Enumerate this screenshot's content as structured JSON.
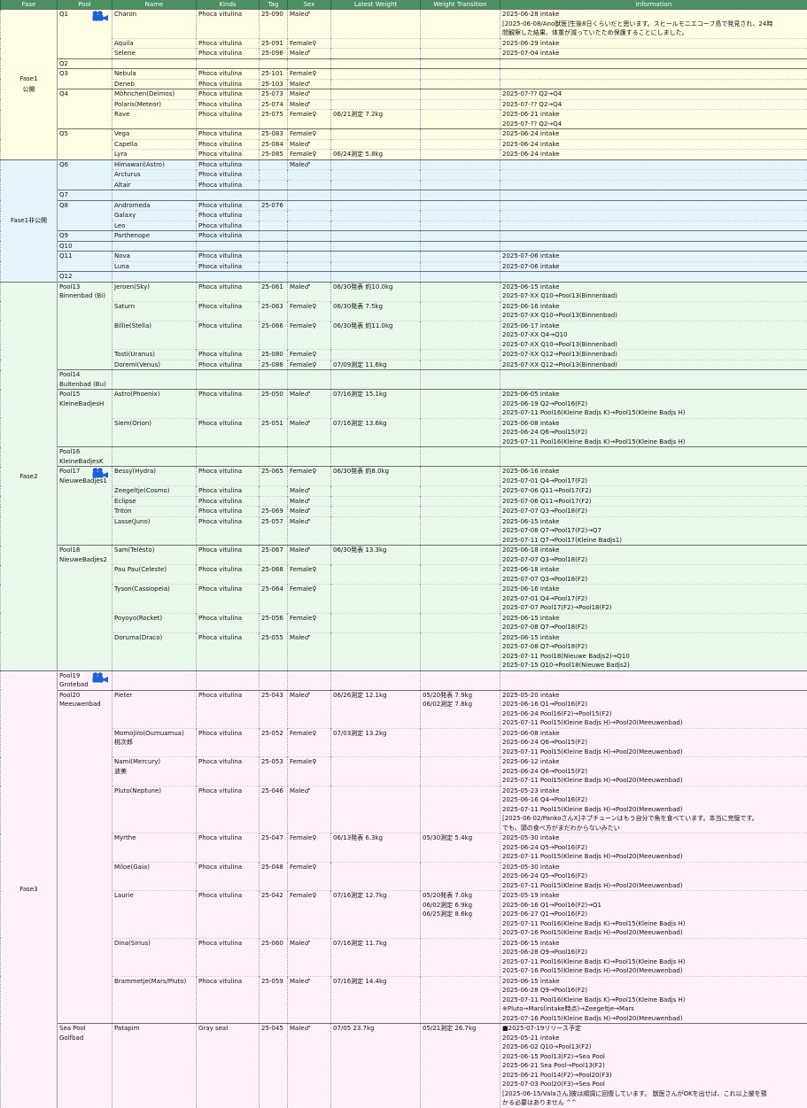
{
  "headers": {
    "fase": "Fase",
    "pool": "Pool",
    "name": "Name",
    "kinds": "Kinds",
    "tag": "Tag",
    "sex": "Sex",
    "weight": "Latest Weight",
    "trans": "Weight Transition",
    "info": "Information"
  },
  "colors": {
    "header": "#4c8f63",
    "fase1_public": "#fffde3",
    "fase1_private": "#e3f4fd",
    "fase2": "#e8f8ea",
    "fase3": "#fdf0fa",
    "camera_icon": "#1f5fd0"
  },
  "fases": [
    {
      "label": "Fase1\n公開",
      "bg": "#fffde3",
      "pools": [
        {
          "label": "Q1",
          "camera": true,
          "animals": [
            {
              "name": "Charon",
              "kinds": "Phoca vitulina",
              "tag": "25-090",
              "sex": "Male♂",
              "weight": "",
              "trans": "",
              "info": [
                "2025-06-28 intake",
                "[2025-06-08/Ano獣医]生後8日くらいだと思います。スヒールモニエコーフ島で発見され、24時",
                "間観察した結果、体重が減っていたため保護することにしました。"
              ]
            },
            {
              "name": "Aquila",
              "kinds": "Phoca vitulina",
              "tag": "25-091",
              "sex": "Female♀",
              "weight": "",
              "trans": "",
              "info": [
                "2025-06-29 intake"
              ]
            },
            {
              "name": "Selene",
              "kinds": "Phoca vitulina",
              "tag": "25-096",
              "sex": "Male♂",
              "weight": "",
              "trans": "",
              "info": [
                "2025-07-04 intake"
              ]
            }
          ]
        },
        {
          "label": "Q2",
          "animals": [
            {}
          ]
        },
        {
          "label": "Q3",
          "animals": [
            {
              "name": "Nebula",
              "kinds": "Phoca vitulina",
              "tag": "25-101",
              "sex": "Female♀",
              "weight": "",
              "trans": "",
              "info": []
            },
            {
              "name": "Deneb",
              "kinds": "Phoca vitulina",
              "tag": "25-103",
              "sex": "Male♂",
              "weight": "",
              "trans": "",
              "info": []
            }
          ]
        },
        {
          "label": "Q4",
          "animals": [
            {
              "name": "Möhnchen(Deimos)",
              "kinds": "Phoca vitulina",
              "tag": "25-073",
              "sex": "Male♂",
              "weight": "",
              "trans": "",
              "info": [
                "2025-07-?? Q2→Q4"
              ]
            },
            {
              "name": "Polaris(Meteor)",
              "kinds": "Phoca vitulina",
              "tag": "25-074",
              "sex": "Male♂",
              "weight": "",
              "trans": "",
              "info": [
                "2025-07-?? Q2→Q4"
              ]
            },
            {
              "name": "Rave",
              "kinds": "Phoca vitulina",
              "tag": "25-075",
              "sex": "Female♀",
              "weight": "06/21測定 7.2kg",
              "trans": "",
              "info": [
                "2025-06-21 intake",
                "2025-07-?? Q2→Q4"
              ]
            }
          ]
        },
        {
          "label": "Q5",
          "animals": [
            {
              "name": "Vega",
              "kinds": "Phoca vitulina",
              "tag": "25-083",
              "sex": "Female♀",
              "weight": "",
              "trans": "",
              "info": [
                "2025-06-24 intake"
              ]
            },
            {
              "name": "Capella",
              "kinds": "Phoca vitulina",
              "tag": "25-084",
              "sex": "Male♂",
              "weight": "",
              "trans": "",
              "info": [
                "2025-06-24 intake"
              ]
            },
            {
              "name": "Lyra",
              "kinds": "Phoca vitulina",
              "tag": "25-085",
              "sex": "Female♀",
              "weight": "06/24測定 5.8kg",
              "trans": "",
              "info": [
                "2025-06-24 intake"
              ]
            }
          ]
        }
      ]
    },
    {
      "label": "Fase1非公開",
      "bg": "#e3f4fd",
      "pools": [
        {
          "label": "Q6",
          "animals": [
            {
              "name": "Himawari(Astro)",
              "kinds": "Phoca vitulina",
              "tag": "",
              "sex": "Male♂",
              "weight": "",
              "trans": "",
              "info": []
            },
            {
              "name": "Arcturus",
              "kinds": "Phoca vitulina",
              "tag": "",
              "sex": "",
              "weight": "",
              "trans": "",
              "info": []
            },
            {
              "name": "Altair",
              "kinds": "Phoca vitulina",
              "tag": "",
              "sex": "",
              "weight": "",
              "trans": "",
              "info": []
            }
          ]
        },
        {
          "label": "Q7",
          "animals": [
            {}
          ]
        },
        {
          "label": "Q8",
          "animals": [
            {
              "name": "Andromeda",
              "kinds": "Phoca vitulina",
              "tag": "25-076",
              "sex": "",
              "weight": "",
              "trans": "",
              "info": []
            },
            {
              "name": "Galaxy",
              "kinds": "Phoca vitulina",
              "tag": "",
              "sex": "",
              "weight": "",
              "trans": "",
              "info": []
            },
            {
              "name": "Leo",
              "kinds": "Phoca vitulina",
              "tag": "",
              "sex": "",
              "weight": "",
              "trans": "",
              "info": []
            }
          ]
        },
        {
          "label": "Q9",
          "animals": [
            {
              "name": "Parthenope",
              "kinds": "Phoca vitulina",
              "tag": "",
              "sex": "",
              "weight": "",
              "trans": "",
              "info": []
            }
          ]
        },
        {
          "label": "Q10",
          "animals": [
            {}
          ]
        },
        {
          "label": "Q11",
          "animals": [
            {
              "name": "Nova",
              "kinds": "Phoca vitulina",
              "tag": "",
              "sex": "",
              "weight": "",
              "trans": "",
              "info": [
                "2025-07-06 intake"
              ]
            },
            {
              "name": "Luna",
              "kinds": "Phoca vitulina",
              "tag": "",
              "sex": "",
              "weight": "",
              "trans": "",
              "info": [
                "2025-07-06 intake"
              ]
            }
          ]
        },
        {
          "label": "Q12",
          "animals": [
            {}
          ]
        }
      ]
    },
    {
      "label": "Fase2",
      "bg": "#e8f8ea",
      "pools": [
        {
          "label": "Pool13\nBinnenbad (Bi)",
          "animals": [
            {
              "name": "Jeroen(Sky)",
              "kinds": "Phoca vitulina",
              "tag": "25-061",
              "sex": "Male♂",
              "weight": "06/30発表 約10.0kg",
              "trans": "",
              "info": [
                "2025-06-15 intake",
                "2025-07-XX Q10→Pool13(Binnenbad)"
              ]
            },
            {
              "name": "Saturn",
              "kinds": "Phoca vitulina",
              "tag": "25-063",
              "sex": "Female♀",
              "weight": "06/30発表 7.5kg",
              "trans": "",
              "info": [
                "2025-06-16 intake",
                "2025-07-XX Q10→Pool13(Binnenbad)"
              ]
            },
            {
              "name": "Billie(Stella)",
              "kinds": "Phoca vitulina",
              "tag": "25-066",
              "sex": "Female♀",
              "weight": "06/30発表 約11.0kg",
              "trans": "",
              "info": [
                "2025-06-17 intake",
                "2025-07-XX Q4→Q10",
                "2025-07-XX Q10→Pool13(Binnenbad)"
              ]
            },
            {
              "name": "Tosti(Uranus)",
              "kinds": "Phoca vitulina",
              "tag": "25-080",
              "sex": "Female♀",
              "weight": "",
              "trans": "",
              "info": [
                "2025-07-XX Q12→Pool13(Binnenbad)"
              ]
            },
            {
              "name": "Doremi(Venus)",
              "kinds": "Phoca vitulina",
              "tag": "25-086",
              "sex": "Female♀",
              "weight": "07/09測定 11.6kg",
              "trans": "",
              "info": [
                "2025-07-XX Q12→Pool13(Binnenbad)"
              ]
            }
          ]
        },
        {
          "label": "Pool14\nBuitenbad (Bu)",
          "animals": [
            {}
          ]
        },
        {
          "label": "Pool15\nKleineBadjesH",
          "animals": [
            {
              "name": "Astro(Phoenix)",
              "kinds": "Phoca vitulina",
              "tag": "25-050",
              "sex": "Male♂",
              "weight": "07/16測定 15.1kg",
              "trans": "",
              "info": [
                "2025-06-05 intake",
                "2025-06-19 Q2→Pool16(F2)",
                "2025-07-11 Pool16(Kleine Badjs K)→Pool15(Kleine Badjs H)"
              ]
            },
            {
              "name": "Siem(Orion)",
              "kinds": "Phoca vitulina",
              "tag": "25-051",
              "sex": "Male♂",
              "weight": "07/16測定 13.6kg",
              "trans": "",
              "info": [
                "2025-06-08 intake",
                "2025-06-24 Q6→Pool15(F2)",
                "2025-07-11 Pool16(Kleine Badjs K)→Pool15(Kleine Badjs H)"
              ]
            }
          ]
        },
        {
          "label": "Pool16\nKleineBadjesK",
          "animals": [
            {}
          ]
        },
        {
          "label": "Pool17\nNieuweBadjes1",
          "camera": true,
          "animals": [
            {
              "name": "Bessy(Hydra)",
              "kinds": "Phoca vitulina",
              "tag": "25-065",
              "sex": "Female♀",
              "weight": "06/30発表 約8.0kg",
              "trans": "",
              "info": [
                "2025-06-16 intake",
                "2025-07-01 Q4→Pool17(F2)"
              ]
            },
            {
              "name": "Zeegeltje(Cosmo)",
              "kinds": "Phoca vitulina",
              "tag": "",
              "sex": "Male♂",
              "weight": "",
              "trans": "",
              "info": [
                "2025-07-06 Q11→Pool17(F2)"
              ]
            },
            {
              "name": "Eclipse",
              "kinds": "Phoca vitulina",
              "tag": "",
              "sex": "Male♂",
              "weight": "",
              "trans": "",
              "info": [
                "2025-07-06 Q11→Pool17(F2)"
              ]
            },
            {
              "name": "Triton",
              "kinds": "Phoca vitulina",
              "tag": "25-069",
              "sex": "Male♂",
              "weight": "",
              "trans": "",
              "info": [
                "2025-07-07 Q3→Pool18(F2)"
              ]
            },
            {
              "name": "Lasse(Juno)",
              "kinds": "Phoca vitulina",
              "tag": "25-057",
              "sex": "Male♂",
              "weight": "",
              "trans": "",
              "info": [
                "2025-06-15 intake",
                "2025-07-08 Q7→Pool17(F2)→Q7",
                "2025-07-11 Q7→Pool17(Kleine Badjs1)"
              ]
            }
          ]
        },
        {
          "label": "Pool18\nNieuweBadjes2",
          "animals": [
            {
              "name": "Sam(Telèsto)",
              "kinds": "Phoca vitulina",
              "tag": "25-067",
              "sex": "Male♂",
              "weight": "06/30発表 13.3kg",
              "trans": "",
              "info": [
                "2025-06-18 intake",
                "2025-07-07 Q3→Pool18(F2)"
              ]
            },
            {
              "name": "Pau Pau(Celeste)",
              "kinds": "Phoca vitulina",
              "tag": "25-068",
              "sex": "Female♀",
              "weight": "",
              "trans": "",
              "info": [
                "2025-06-18 intake",
                "2025-07-07 Q3→Pool18(F2)"
              ]
            },
            {
              "name": "Tyson(Cassiopeia)",
              "kinds": "Phoca vitulina",
              "tag": "25-064",
              "sex": "Female♀",
              "weight": "",
              "trans": "",
              "info": [
                "2025-06-16 intake",
                "2025-07-01 Q4→Pool17(F2)",
                "2025-07-07 Pool17(F2)→Pool18(F2)"
              ]
            },
            {
              "name": "Poyoyo(Rocket)",
              "kinds": "Phoca vitulina",
              "tag": "25-056",
              "sex": "Female♀",
              "weight": "",
              "trans": "",
              "info": [
                "2025-06-15 intake",
                "2025-07-08 Q7→Pool18(F2)"
              ]
            },
            {
              "name": "Doruma(Draco)",
              "kinds": "Phoca vitulina",
              "tag": "25-055",
              "sex": "Male♂",
              "weight": "",
              "trans": "",
              "info": [
                "2025-06-15 intake",
                "2025-07-08 Q7→Pool18(F2)",
                "2025-07-11 Pool18(Nieuwe Badjs2)→Q10",
                "2025-07-15 Q10→Pool18(Nieuwe Badjs2)"
              ]
            }
          ]
        }
      ]
    },
    {
      "label": "Fase3",
      "bg": "#fdf0fa",
      "pools": [
        {
          "label": "Pool19\nGrotebad",
          "camera": true,
          "animals": [
            {}
          ]
        },
        {
          "label": "Pool20\nMeeuwenbad",
          "animals": [
            {
              "name": "Pieter",
              "kinds": "Phoca vitulina",
              "tag": "25-043",
              "sex": "Male♂",
              "weight": "06/26測定 12.1kg",
              "trans": "05/20発表 7.9kg\n06/02測定 7.8kg",
              "info": [
                "2025-05-20 intake",
                "2025-06-16 Q1→Pool16(F2)",
                "2025-06-24 Pool16(F2)→Pool15(F2)",
                "2025-07-11 Pool15(Kleine Badjs H)→Pool20(Meeuwenbad)"
              ]
            },
            {
              "name": "Momojiro(Oumuamua)\n桃次郎",
              "kinds": "Phoca vitulina",
              "tag": "25-052",
              "sex": "Female♀",
              "weight": "07/03測定 13.2kg",
              "trans": "",
              "info": [
                "2025-06-08 intake",
                "2025-06-24 Q6→Pool15(F2)",
                "2025-07-11 Pool15(Kleine Badjs H)→Pool20(Meeuwenbad)"
              ]
            },
            {
              "name": "Nami(Mercury)\n波美",
              "kinds": "Phoca vitulina",
              "tag": "25-053",
              "sex": "Female♀",
              "weight": "",
              "trans": "",
              "info": [
                "2025-06-12 intake",
                "2025-06-24 Q6→Pool15(F2)",
                "2025-07-11 Pool15(Kleine Badjs H)→Pool20(Meeuwenbad)"
              ]
            },
            {
              "name": "Pluto(Neptune)",
              "kinds": "Phoca vitulina",
              "tag": "25-046",
              "sex": "Male♂",
              "weight": "",
              "trans": "",
              "info": [
                "2025-05-23 intake",
                "2025-06-16 Q4→Pool16(F2)",
                "2025-07-11 Pool15(Kleine Badjs H)→Pool20(Meeuwenbad)",
                "[2025-06-02/PankoさんX]ネプチューンはもう自分で魚を食べています。本当に完璧です。",
                "でも、頭の食べ方がまだわからないみたい"
              ]
            },
            {
              "name": "Myrthe",
              "kinds": "Phoca vitulina",
              "tag": "25-047",
              "sex": "Female♀",
              "weight": "06/13発表 6.3kg",
              "trans": "05/30測定 5.4kg",
              "info": [
                "2025-05-30 intake",
                "2025-06-24 Q5→Pool16(F2)",
                "2025-07-11 Pool15(Kleine Badjs H)→Pool20(Meeuwenbad)"
              ]
            },
            {
              "name": "Miloe(Gaia)",
              "kinds": "Phoca vitulina",
              "tag": "25-048",
              "sex": "Female♀",
              "weight": "",
              "trans": "",
              "info": [
                "2025-05-30 intake",
                "2025-06-24 Q5→Pool16(F2)",
                "2025-07-11 Pool15(Kleine Badjs H)→Pool20(Meeuwenbad)"
              ]
            },
            {
              "name": "Laurie",
              "kinds": "Phoca vitulina",
              "tag": "25-042",
              "sex": "Female♀",
              "weight": "07/16測定 12.7kg",
              "trans": "05/20発表 7.0kg\n06/02測定 6.9kg\n06/25測定 8.6kg",
              "info": [
                "2025-05-19 intake",
                "2025-06-16 Q1→Pool16(F2)→Q1",
                "2025-06-27 Q1→Pool16(F2)",
                "2025-07-11 Pool16(Kleine Badjs K)→Pool15(Kleine Badjs H)",
                "2025-07-16 Pool15(Kleine Badjs H)→Pool20(Meeuwenbad)"
              ]
            },
            {
              "name": "Dina(Sirius)",
              "kinds": "Phoca vitulina",
              "tag": "25-060",
              "sex": "Male♂",
              "weight": "07/16測定 11.7kg",
              "trans": "",
              "info": [
                "2025-06-15 intake",
                "2025-06-28 Q9→Pool16(F2)",
                "2025-07-11 Pool16(Kleine Badjs K)→Pool15(Kleine Badjs H)",
                "2025-07-16 Pool15(Kleine Badjs H)→Pool20(Meeuwenbad)"
              ]
            },
            {
              "name": "Brammetje(Mars/Pluto)",
              "kinds": "Phoca vitulina",
              "tag": "25-059",
              "sex": "Male♂",
              "weight": "07/16測定 14.4kg",
              "trans": "",
              "info": [
                "2025-06-15 intake",
                "2025-06-28 Q9→Pool16(F2)",
                "2025-07-11 Pool16(Kleine Badjs K)→Pool15(Kleine Badjs H)",
                "※Pluto→Mars(intake時点)→Zeegeltje→Mars",
                "2025-07-16 Pool15(Kleine Badjs H)→Pool20(Meeuwenbad)"
              ]
            }
          ]
        },
        {
          "label": "Sea Pool\nGolfbad",
          "animals": [
            {
              "name": "Patapim",
              "kinds": "Gray seal",
              "tag": "25-045",
              "sex": "Male♂",
              "weight": "07/05 23.7kg",
              "trans": "05/21測定 26.7kg",
              "info": [
                "■2025-07-19リリース予定",
                "2025-05-21 intake",
                "2025-06-02 Q10→Pool13(F2)",
                "2025-06-15 Pool13(F2)→Sea Pool",
                "2025-06-21 Sea Pool→Pool13(F2)",
                "2025-06-21 Pool14(F2)→Pool20(F3)",
                "2025-07-03 Pool20(F3)→Sea Pool",
                "[2025-06-15/Valaさん]彼は順調に回復しています。 獣医さんがOKを出せば、これ以上彼を預",
                "かる必要はありません ^^"
              ]
            }
          ]
        }
      ]
    }
  ]
}
